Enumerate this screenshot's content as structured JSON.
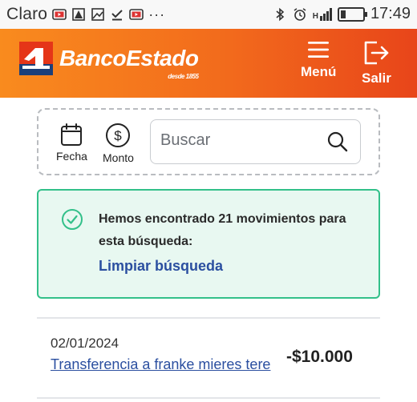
{
  "status_bar": {
    "carrier": "Claro",
    "time": "17:49",
    "network": "H",
    "more": "···"
  },
  "header": {
    "brand": "BancoEstado",
    "brand_sub": "desde 1855",
    "menu_label": "Menú",
    "exit_label": "Salir",
    "colors": {
      "start": "#f98b1e",
      "end": "#e8451a"
    }
  },
  "search": {
    "filter_date_label": "Fecha",
    "filter_amount_label": "Monto",
    "placeholder": "Buscar",
    "value": ""
  },
  "result": {
    "message": "Hemos encontrado 21 movimientos para esta búsqueda:",
    "clear_label": "Limpiar búsqueda",
    "accent": "#33c08a"
  },
  "transactions": [
    {
      "date": "02/01/2024",
      "description": "Transferencia a franke mieres tere",
      "amount": "-$10.000"
    }
  ]
}
